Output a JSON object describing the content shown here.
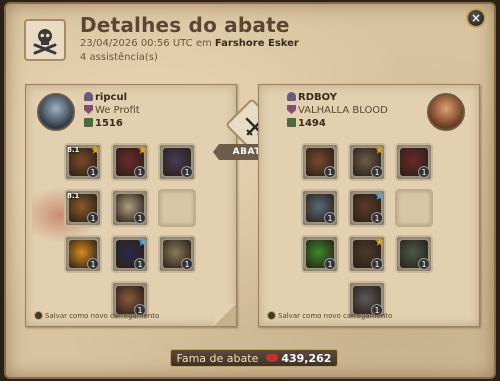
{
  "header": {
    "icon": "skull-crossbones-icon",
    "title": "Detalhes do abate",
    "datetime": "23/04/2026 00:56 UTC",
    "location_prefix": "em",
    "location": "Farshore Esker",
    "assists": "4 assistência(s)"
  },
  "close_label": "×",
  "vs": {
    "icon": "crossed-swords-icon",
    "label": "ABATEU"
  },
  "killer": {
    "name": "ripcul",
    "guild": "We Profit",
    "item_power": "1516",
    "footnote": "Salvar como novo carregamento",
    "slots": [
      {
        "name": "bag-slot",
        "icon": "bag-icon",
        "color": "#7a4a2a",
        "qty": "1",
        "tier": "8.1",
        "ench": "gold"
      },
      {
        "name": "head-slot",
        "icon": "hood-icon",
        "color": "#6a2a2a",
        "qty": "1",
        "tier": "",
        "ench": "gold"
      },
      {
        "name": "cape-slot",
        "icon": "cape-icon",
        "color": "#4a3a5a",
        "qty": "1",
        "tier": "",
        "ench": ""
      },
      {
        "name": "mainhand-slot",
        "icon": "crossbow-icon",
        "color": "#8a5a2a",
        "qty": "1",
        "tier": "8.1",
        "ench": ""
      },
      {
        "name": "armor-slot",
        "icon": "robe-icon",
        "color": "#b0a080",
        "qty": "1",
        "tier": "",
        "ench": ""
      },
      {
        "name": "offhand-slot",
        "icon": "empty",
        "color": "",
        "qty": "",
        "tier": "",
        "ench": ""
      },
      {
        "name": "potion-slot",
        "icon": "potion-icon",
        "color": "#d88a20",
        "qty": "1",
        "tier": "",
        "ench": ""
      },
      {
        "name": "shoes-slot",
        "icon": "boots-icon",
        "color": "#2a2a4a",
        "qty": "1",
        "tier": "",
        "ench": "blue"
      },
      {
        "name": "food-slot",
        "icon": "food-icon",
        "color": "#8a7a5a",
        "qty": "1",
        "tier": "",
        "ench": ""
      },
      {
        "name": "mount-slot",
        "icon": "mount-icon",
        "color": "#8a5a3a",
        "qty": "1",
        "tier": "",
        "ench": ""
      }
    ]
  },
  "victim": {
    "name": "RDBOY",
    "guild": "VALHALLA BLOOD",
    "item_power": "1494",
    "footnote": "Salvar como novo carregamento",
    "slots": [
      {
        "name": "bag-slot",
        "icon": "bag-icon",
        "color": "#7a4a2a",
        "qty": "1",
        "tier": "",
        "ench": ""
      },
      {
        "name": "head-slot",
        "icon": "helmet-icon",
        "color": "#6a5a4a",
        "qty": "1",
        "tier": "",
        "ench": "gold"
      },
      {
        "name": "cape-slot",
        "icon": "cape-icon",
        "color": "#6a2a2a",
        "qty": "1",
        "tier": "",
        "ench": ""
      },
      {
        "name": "mainhand-slot",
        "icon": "spear-icon",
        "color": "#5a6a7a",
        "qty": "1",
        "tier": "",
        "ench": ""
      },
      {
        "name": "armor-slot",
        "icon": "armor-icon",
        "color": "#5a3a2a",
        "qty": "1",
        "tier": "",
        "ench": "blue"
      },
      {
        "name": "offhand-slot",
        "icon": "empty",
        "color": "",
        "qty": "",
        "tier": "",
        "ench": ""
      },
      {
        "name": "potion-slot",
        "icon": "potion-icon",
        "color": "#3a8a2a",
        "qty": "1",
        "tier": "",
        "ench": ""
      },
      {
        "name": "shoes-slot",
        "icon": "boots-icon",
        "color": "#4a3a2a",
        "qty": "1",
        "tier": "",
        "ench": "gold"
      },
      {
        "name": "food-slot",
        "icon": "food-icon",
        "color": "#4a5a4a",
        "qty": "1",
        "tier": "",
        "ench": ""
      },
      {
        "name": "mount-slot",
        "icon": "wolf-mount-icon",
        "color": "#5a5a5a",
        "qty": "1",
        "tier": "",
        "ench": ""
      }
    ]
  },
  "fame": {
    "label": "Fama de abate",
    "icon": "fame-icon",
    "value": "439,262"
  }
}
